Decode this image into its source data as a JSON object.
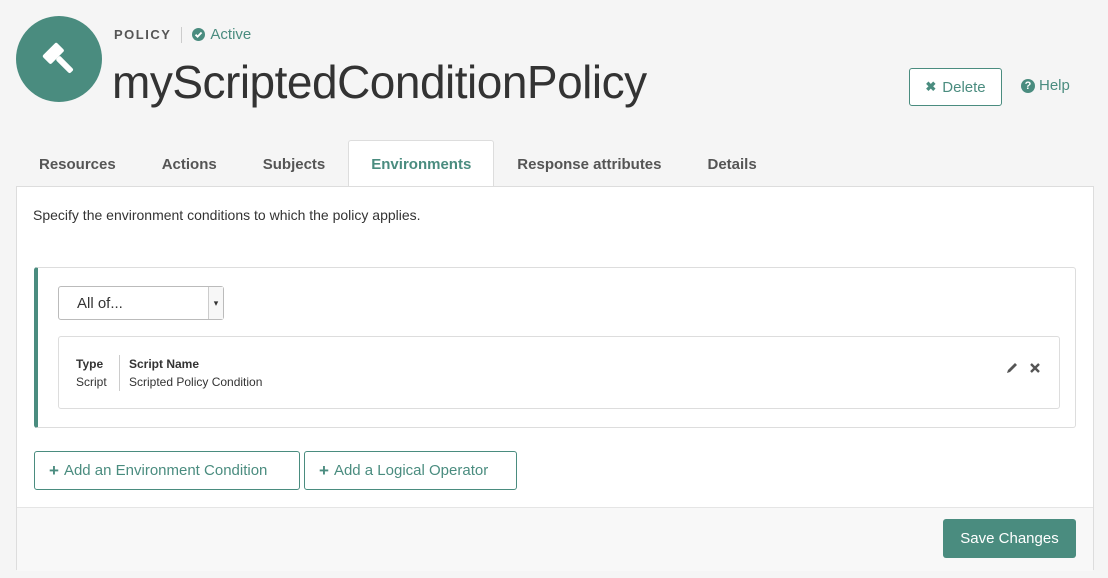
{
  "header": {
    "logo_icon": "gavel-icon",
    "kind_label": "POLICY",
    "status_label": "Active",
    "title": "myScriptedConditionPolicy",
    "delete_label": "Delete",
    "help_label": "Help"
  },
  "tabs": [
    {
      "label": "Resources",
      "active": false
    },
    {
      "label": "Actions",
      "active": false
    },
    {
      "label": "Subjects",
      "active": false
    },
    {
      "label": "Environments",
      "active": true
    },
    {
      "label": "Response attributes",
      "active": false
    },
    {
      "label": "Details",
      "active": false
    }
  ],
  "panel": {
    "intro": "Specify the environment conditions to which the policy applies.",
    "operator_select": {
      "value": "All of..."
    },
    "condition": {
      "type_header": "Type",
      "type_value": "Script",
      "name_header": "Script Name",
      "name_value": "Scripted Policy Condition"
    },
    "add_condition_label": "Add an Environment Condition",
    "add_operator_label": "Add a Logical Operator",
    "save_label": "Save Changes"
  },
  "colors": {
    "accent": "#4a8c7f",
    "background": "#f5f5f5"
  }
}
